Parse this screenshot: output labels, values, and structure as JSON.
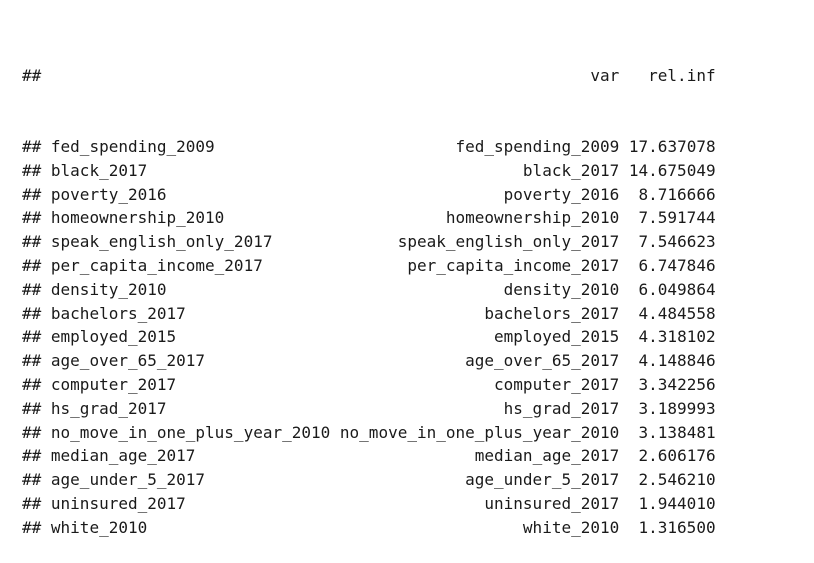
{
  "output": {
    "prefix": "##",
    "columns": {
      "var": "var",
      "rel_inf": "rel.inf"
    },
    "rows": [
      {
        "name": "fed_spending_2009",
        "var": "fed_spending_2009",
        "rel_inf": "17.637078"
      },
      {
        "name": "black_2017",
        "var": "black_2017",
        "rel_inf": "14.675049"
      },
      {
        "name": "poverty_2016",
        "var": "poverty_2016",
        "rel_inf": "8.716666"
      },
      {
        "name": "homeownership_2010",
        "var": "homeownership_2010",
        "rel_inf": "7.591744"
      },
      {
        "name": "speak_english_only_2017",
        "var": "speak_english_only_2017",
        "rel_inf": "7.546623"
      },
      {
        "name": "per_capita_income_2017",
        "var": "per_capita_income_2017",
        "rel_inf": "6.747846"
      },
      {
        "name": "density_2010",
        "var": "density_2010",
        "rel_inf": "6.049864"
      },
      {
        "name": "bachelors_2017",
        "var": "bachelors_2017",
        "rel_inf": "4.484558"
      },
      {
        "name": "employed_2015",
        "var": "employed_2015",
        "rel_inf": "4.318102"
      },
      {
        "name": "age_over_65_2017",
        "var": "age_over_65_2017",
        "rel_inf": "4.148846"
      },
      {
        "name": "computer_2017",
        "var": "computer_2017",
        "rel_inf": "3.342256"
      },
      {
        "name": "hs_grad_2017",
        "var": "hs_grad_2017",
        "rel_inf": "3.189993"
      },
      {
        "name": "no_move_in_one_plus_year_2010",
        "var": "no_move_in_one_plus_year_2010",
        "rel_inf": "3.138481"
      },
      {
        "name": "median_age_2017",
        "var": "median_age_2017",
        "rel_inf": "2.606176"
      },
      {
        "name": "age_under_5_2017",
        "var": "age_under_5_2017",
        "rel_inf": "2.546210"
      },
      {
        "name": "uninsured_2017",
        "var": "uninsured_2017",
        "rel_inf": "1.944010"
      },
      {
        "name": "white_2010",
        "var": "white_2010",
        "rel_inf": "1.316500"
      }
    ]
  }
}
